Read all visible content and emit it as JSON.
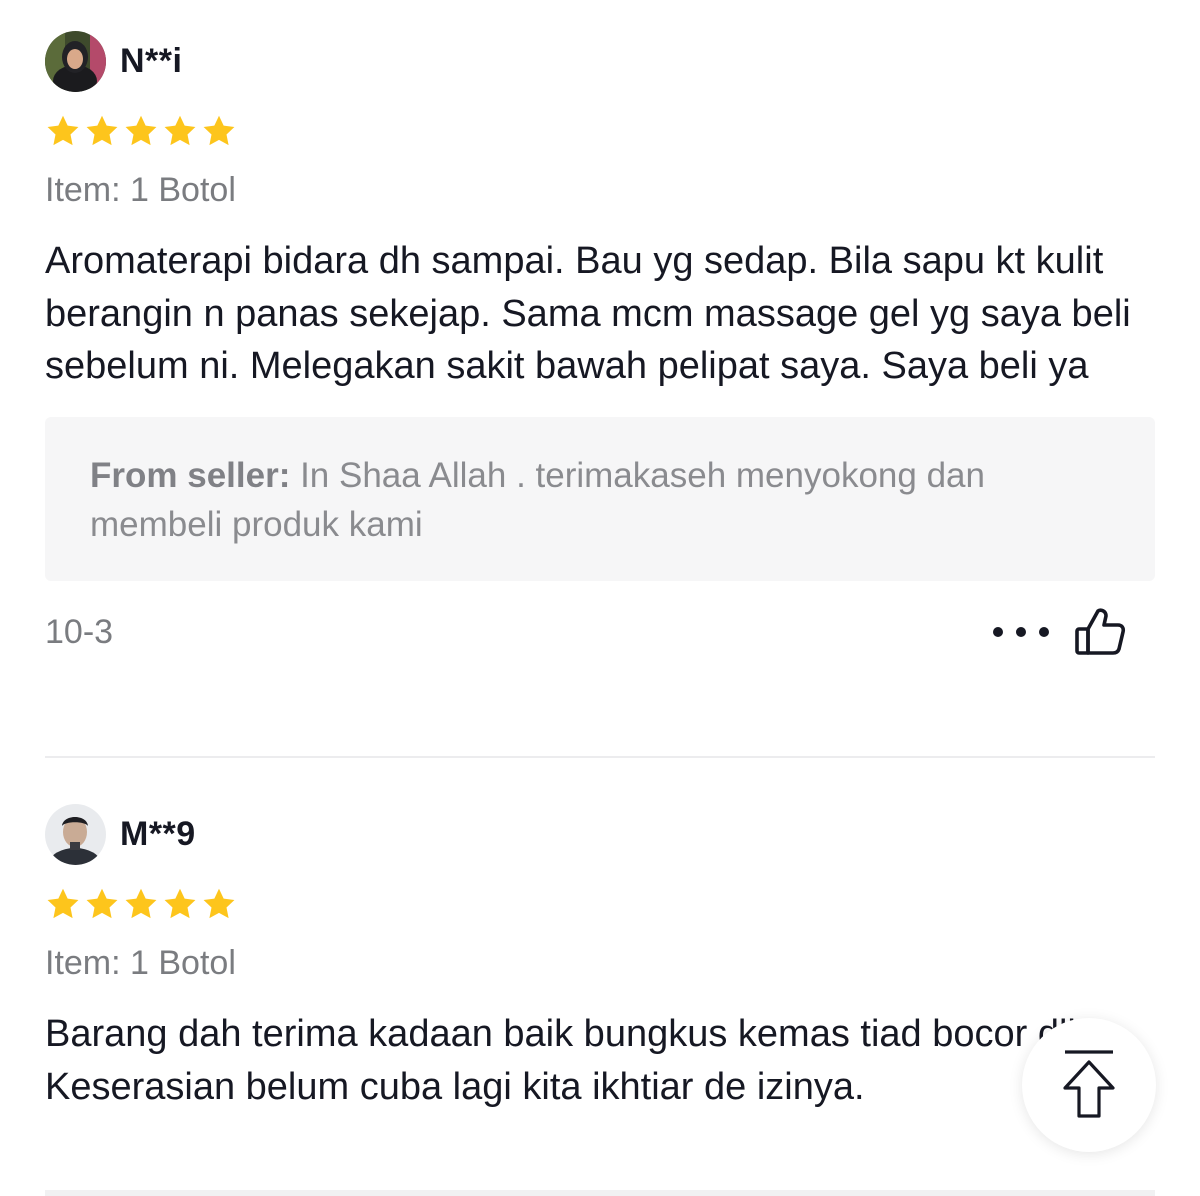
{
  "reviews": [
    {
      "username": "N**i",
      "rating": 5,
      "item": "Item: 1 Botol",
      "text": "Aromaterapi bidara dh sampai. Bau yg sedap. Bila sapu kt kulit berangin n panas sekejap. Sama mcm massage gel yg saya beli sebelum ni. Melegakan sakit bawah pelipat saya. Saya beli ya",
      "seller_reply_label": "From seller:",
      "seller_reply_text": " In Shaa Allah . terimakaseh menyokong dan membeli produk kami",
      "date": "10-3"
    },
    {
      "username": "M**9",
      "rating": 5,
      "item": "Item: 1 Botol",
      "text": "Barang dah terima kadaan baik bungkus kemas tiad bocor dll. Keserasian belum cuba lagi kita ikhtiar de izinya."
    }
  ],
  "icons": {
    "star": "star-icon",
    "more": "more-horizontal-icon",
    "like": "thumbs-up-icon",
    "scroll_top": "arrow-up-to-top-icon"
  },
  "colors": {
    "star": "#fdc51c",
    "text": "#161823",
    "muted": "#7a7c80",
    "reply_bg": "#f6f6f7"
  }
}
